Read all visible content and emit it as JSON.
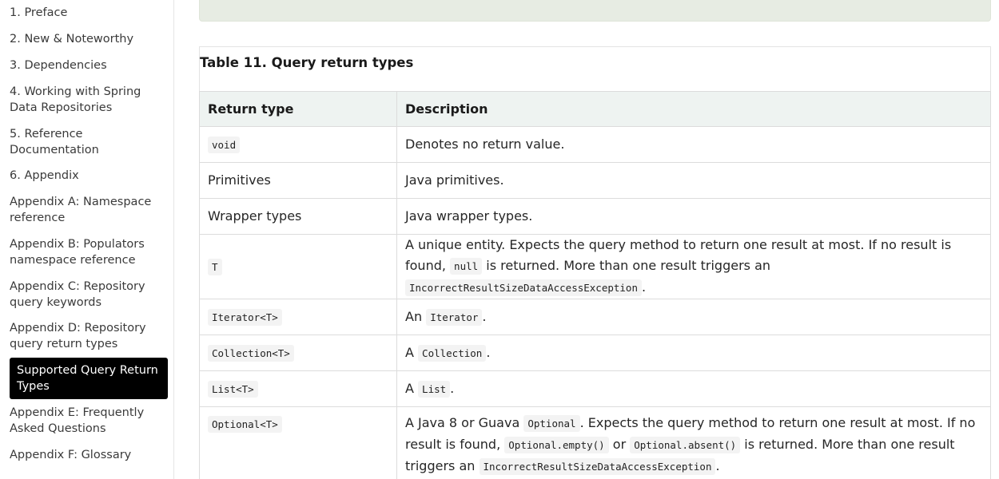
{
  "sidebar": {
    "items": [
      {
        "label": "1. Preface"
      },
      {
        "label": "2. New & Noteworthy"
      },
      {
        "label": "3. Dependencies"
      },
      {
        "label": "4. Working with Spring Data Repositories"
      },
      {
        "label": "5. Reference Documentation"
      },
      {
        "label": "6. Appendix"
      },
      {
        "label": "Appendix A: Namespace reference"
      },
      {
        "label": "Appendix B: Populators namespace reference"
      },
      {
        "label": "Appendix C: Repository query keywords"
      },
      {
        "label": "Appendix D: Repository query return types"
      },
      {
        "label": "Supported Query Return Types",
        "active": true
      },
      {
        "label": "Appendix E: Frequently Asked Questions"
      },
      {
        "label": "Appendix F: Glossary"
      }
    ]
  },
  "table": {
    "caption": "Table 11. Query return types",
    "headers": [
      "Return type",
      "Description"
    ],
    "rows": [
      {
        "type": "void",
        "desc": "Denotes no return value."
      },
      {
        "type": "Primitives",
        "desc": "Java primitives."
      },
      {
        "type": "Wrapper types",
        "desc": "Java wrapper types."
      },
      {
        "type": "T",
        "desc_a": "A unique entity. Expects the query method to return one result at most. If no result is found,",
        "desc_code1": "null",
        "desc_b": "is returned. More than one result triggers an",
        "desc_code2": "IncorrectResultSizeDataAccessException",
        "desc_c": "."
      },
      {
        "type": "Iterator<T>",
        "desc_a": "An",
        "desc_code1": "Iterator",
        "desc_b": "."
      },
      {
        "type": "Collection<T>",
        "desc_a": "A",
        "desc_code1": "Collection",
        "desc_b": "."
      },
      {
        "type": "List<T>",
        "desc_a": "A",
        "desc_code1": "List",
        "desc_b": "."
      },
      {
        "type": "Optional<T>",
        "desc_a": "A Java 8 or Guava",
        "desc_code1": "Optional",
        "desc_b": ". Expects the query method to return one result at most. If no result is found,",
        "desc_code2": "Optional.empty()",
        "desc_c": "or",
        "desc_code3": "Optional.absent()",
        "desc_d": "is returned. More than one result triggers an",
        "desc_code4": "IncorrectResultSizeDataAccessException",
        "desc_e": "."
      }
    ]
  }
}
